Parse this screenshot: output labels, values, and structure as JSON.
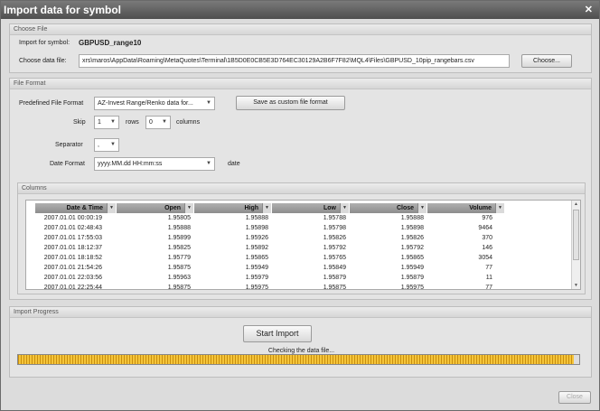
{
  "window": {
    "title": "Import data for symbol"
  },
  "choose_file": {
    "title": "Choose File",
    "symbol_label": "Import for symbol:",
    "symbol_value": "GBPUSD_range10",
    "data_file_label": "Choose data file:",
    "data_file_value": "xrs\\maros\\AppData\\Roaming\\MetaQuotes\\Terminal\\1B5D0E0CB5E3D764EC30129A2B6F7F82\\MQL4\\Files\\GBPUSD_10pip_rangebars.csv",
    "choose_button": "Choose..."
  },
  "file_format": {
    "title": "File Format",
    "predefined_label": "Predefined File Format",
    "predefined_value": "AZ-Invest Range/Renko data for...",
    "save_button": "Save as custom file format",
    "skip_label": "Skip",
    "skip_rows_value": "1",
    "rows_label": "rows",
    "skip_cols_value": "0",
    "columns_label": "columns",
    "separator_label": "Separator",
    "separator_value": ",",
    "date_format_label": "Date Format",
    "date_format_value": "yyyy.MM.dd HH:mm:ss",
    "date_suffix": "date"
  },
  "columns": {
    "title": "Columns",
    "headers": [
      "Date & Time",
      "Open",
      "High",
      "Low",
      "Close",
      "Volume"
    ],
    "rows": [
      [
        "2007.01.01 00:00:19",
        "1.95805",
        "1.95888",
        "1.95788",
        "1.95888",
        "976"
      ],
      [
        "2007.01.01 02:48:43",
        "1.95888",
        "1.95898",
        "1.95798",
        "1.95898",
        "9464"
      ],
      [
        "2007.01.01 17:55:03",
        "1.95899",
        "1.95926",
        "1.95826",
        "1.95826",
        "370"
      ],
      [
        "2007.01.01 18:12:37",
        "1.95825",
        "1.95892",
        "1.95792",
        "1.95792",
        "146"
      ],
      [
        "2007.01.01 18:18:52",
        "1.95779",
        "1.95865",
        "1.95765",
        "1.95865",
        "3054"
      ],
      [
        "2007.01.01 21:54:26",
        "1.95875",
        "1.95949",
        "1.95849",
        "1.95949",
        "77"
      ],
      [
        "2007.01.01 22:03:56",
        "1.95963",
        "1.95979",
        "1.95879",
        "1.95879",
        "11"
      ],
      [
        "2007.01.01 22:25:44",
        "1.95875",
        "1.95975",
        "1.95875",
        "1.95975",
        "77"
      ]
    ]
  },
  "import_progress": {
    "title": "Import Progress",
    "start_button": "Start Import",
    "status": "Checking the data file...",
    "progress_fraction": 0.99
  },
  "footer": {
    "close_button": "Close"
  },
  "icons": {
    "dropdown": "chevron-down-icon",
    "sort": "chevron-down-icon",
    "close": "close-icon"
  }
}
